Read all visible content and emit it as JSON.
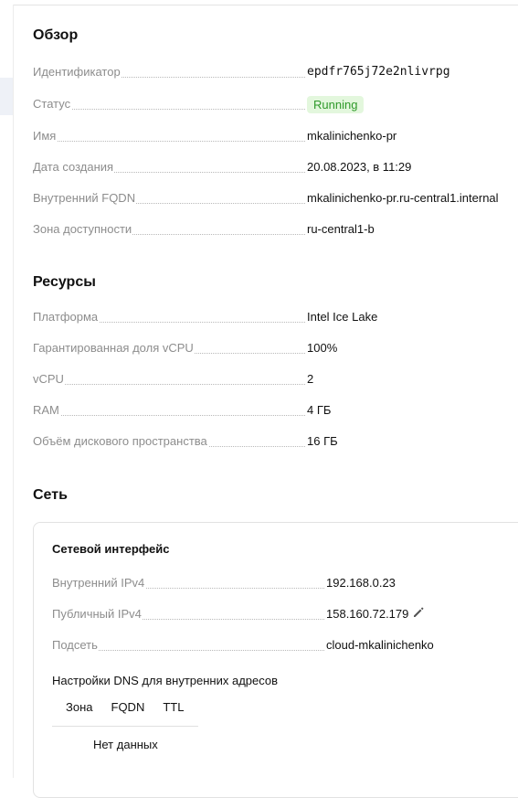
{
  "overview": {
    "title": "Обзор",
    "rows": [
      {
        "label": "Идентификатор",
        "value": "epdfr765j72e2nlivrpg"
      },
      {
        "label": "Статус",
        "value": "Running"
      },
      {
        "label": "Имя",
        "value": "mkalinichenko-pr"
      },
      {
        "label": "Дата создания",
        "value": "20.08.2023, в 11:29"
      },
      {
        "label": "Внутренний FQDN",
        "value": "mkalinichenko-pr.ru-central1.internal"
      },
      {
        "label": "Зона доступности",
        "value": "ru-central1-b"
      }
    ]
  },
  "resources": {
    "title": "Ресурсы",
    "rows": [
      {
        "label": "Платформа",
        "value": "Intel Ice Lake"
      },
      {
        "label": "Гарантированная доля vCPU",
        "value": "100%"
      },
      {
        "label": "vCPU",
        "value": "2"
      },
      {
        "label": "RAM",
        "value": "4 ГБ"
      },
      {
        "label": "Объём дискового пространства",
        "value": "16 ГБ"
      }
    ]
  },
  "network": {
    "title": "Сеть",
    "interface": {
      "title": "Сетевой интерфейс",
      "rows": [
        {
          "label": "Внутренний IPv4",
          "value": "192.168.0.23"
        },
        {
          "label": "Публичный IPv4",
          "value": "158.160.72.179"
        },
        {
          "label": "Подсеть",
          "value": "cloud-mkalinichenko"
        }
      ],
      "dns": {
        "title": "Настройки DNS для внутренних адресов",
        "columns": [
          "Зона",
          "FQDN",
          "TTL"
        ],
        "empty": "Нет данных"
      }
    }
  },
  "colors": {
    "status_bg": "#e3f7dd",
    "status_text": "#2f9a2a",
    "link": "#3a7ad6"
  },
  "icons": {
    "edit": "pencil-icon"
  }
}
